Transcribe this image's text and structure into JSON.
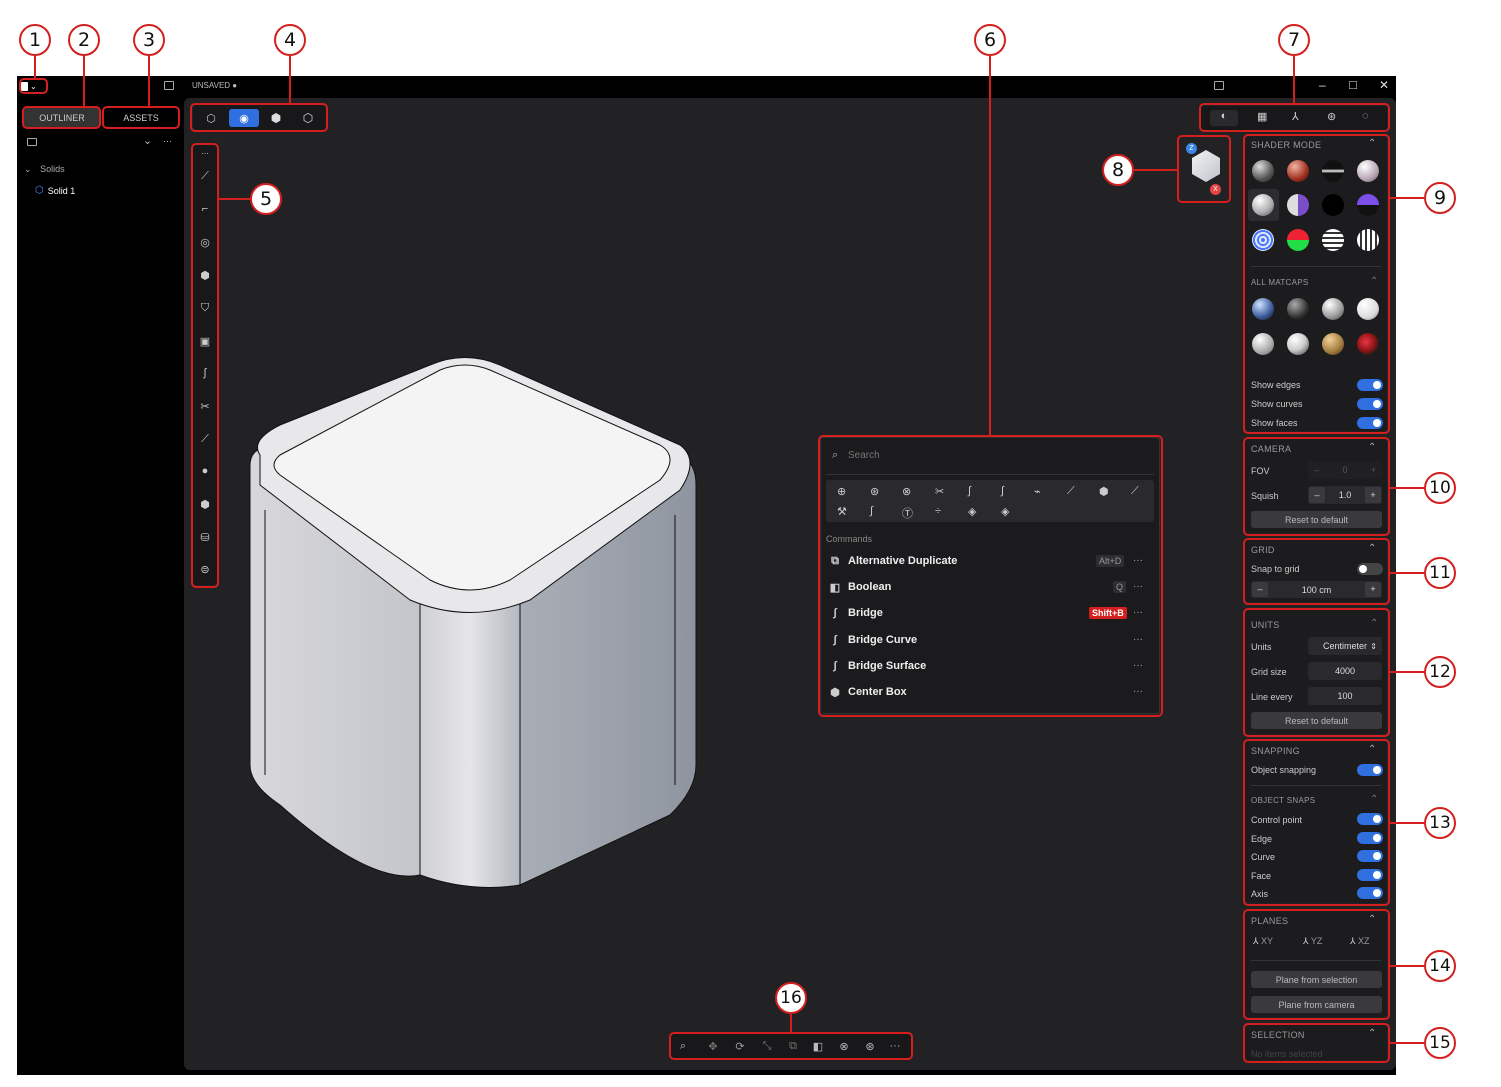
{
  "titlebar": {
    "doc_title": "UNSAVED ●",
    "minimize": "–",
    "maximize": "□",
    "close": "✕"
  },
  "left_tabs": {
    "outliner": "OUTLINER",
    "assets": "ASSETS"
  },
  "outliner": {
    "group": "Solids",
    "item": "Solid 1",
    "chevron": "⌄",
    "more": "···"
  },
  "viewport_modes": [
    "mode-object",
    "mode-solid",
    "mode-box",
    "mode-wire"
  ],
  "view_toolbar": [
    "contrast-icon",
    "grid-icon",
    "axes-icon",
    "sphere-icon",
    "circle-icon"
  ],
  "search": {
    "placeholder": "Search"
  },
  "commands": {
    "header": "Commands",
    "items": [
      {
        "label": "Alternative Duplicate",
        "shortcut": "Alt+D"
      },
      {
        "label": "Boolean",
        "shortcut": "Q"
      },
      {
        "label": "Bridge",
        "shortcut": "Shift+B"
      },
      {
        "label": "Bridge Curve",
        "shortcut": ""
      },
      {
        "label": "Bridge Surface",
        "shortcut": ""
      },
      {
        "label": "Center Box",
        "shortcut": ""
      }
    ]
  },
  "gizmo": {
    "z": "Z",
    "x": "X"
  },
  "shader": {
    "title": "SHADER MODE",
    "all_matcaps": "ALL MATCAPS",
    "show_edges": "Show edges",
    "show_curves": "Show curves",
    "show_faces": "Show faces"
  },
  "camera": {
    "title": "CAMERA",
    "fov": "FOV",
    "fov_value": "0",
    "squish": "Squish",
    "squish_value": "1.0",
    "reset": "Reset to default"
  },
  "grid": {
    "title": "GRID",
    "snap": "Snap to grid",
    "size": "100 cm",
    "minus": "–",
    "plus": "+"
  },
  "units": {
    "title": "UNITS",
    "units_label": "Units",
    "units_value": "Centimeter",
    "grid_size_label": "Grid size",
    "grid_size": "4000",
    "line_every_label": "Line every",
    "line_every": "100",
    "reset": "Reset to default"
  },
  "snapping": {
    "title": "SNAPPING",
    "object_snapping": "Object snapping",
    "object_snaps": "OBJECT SNAPS",
    "control_point": "Control point",
    "edge": "Edge",
    "curve": "Curve",
    "face": "Face",
    "axis": "Axis"
  },
  "planes": {
    "title": "PLANES",
    "xy": "XY",
    "yz": "YZ",
    "xz": "XZ",
    "from_selection": "Plane from selection",
    "from_camera": "Plane from camera"
  },
  "selection": {
    "title": "SELECTION",
    "empty": "No items selected"
  },
  "callouts": [
    "1",
    "2",
    "3",
    "4",
    "5",
    "6",
    "7",
    "8",
    "9",
    "10",
    "11",
    "12",
    "13",
    "14",
    "15",
    "16"
  ],
  "colors": {
    "accent": "#2f6fe0",
    "highlight": "#d41f1f",
    "bg": "#222225"
  }
}
